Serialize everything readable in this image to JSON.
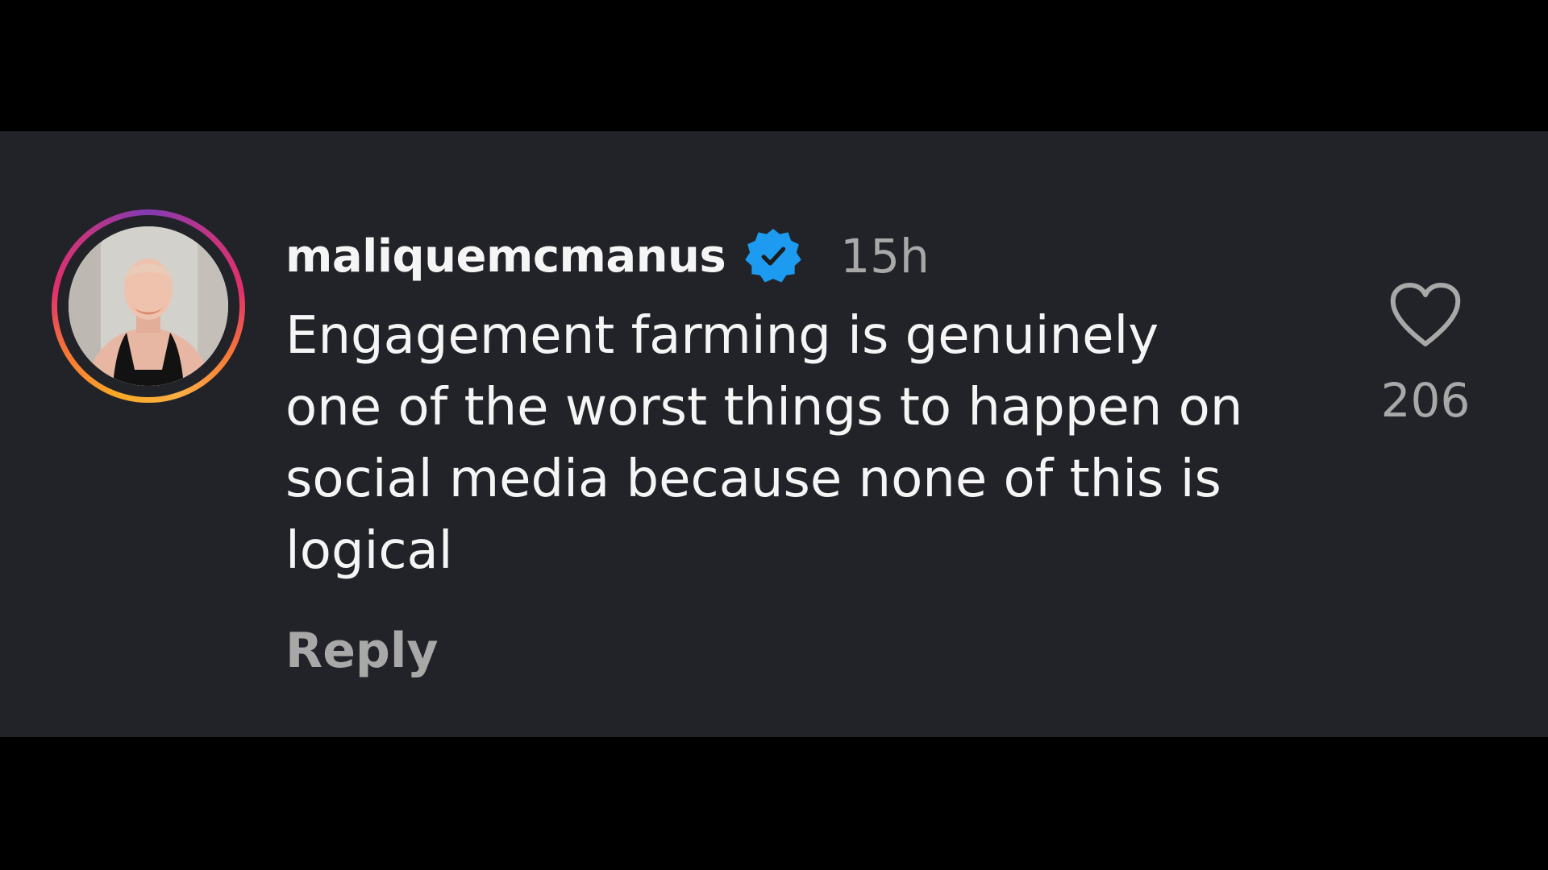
{
  "comment": {
    "username": "maliquemcmanus",
    "verified": true,
    "timestamp": "15h",
    "text": "Engagement farming is genuinely\none of the worst things to happen on\nsocial media because none of this is\nlogical",
    "reply_label": "Reply",
    "like_count": "206",
    "like_icon": "heart-outline-icon",
    "verified_icon": "verified-badge-icon"
  },
  "colors": {
    "background": "#000000",
    "panel": "#222328",
    "primary_text": "#f5f5f5",
    "secondary_text": "#a8a8a8",
    "verified_blue": "#1d9bf0"
  }
}
